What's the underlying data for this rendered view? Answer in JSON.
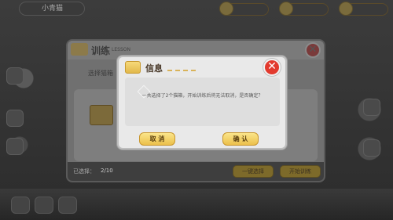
{
  "top_bar": {
    "player_label": "小青猫"
  },
  "training_panel": {
    "title": "训练",
    "subtitle": "LESSON",
    "select_prompt": "选择猫箱",
    "selected_label": "已选择：",
    "selected_count": "2/10",
    "select_all_button": "一键选择",
    "start_button": "开始训练"
  },
  "dialog": {
    "title": "信息",
    "message": "一共选择了2个猫箱，开始训练后将无法取消，是否确定？",
    "cancel_button": "取 消",
    "confirm_button": "确 认"
  },
  "icons": {
    "dialog_close": "close-icon",
    "panel_close": "close-icon",
    "title_box": "box-icon"
  },
  "colors": {
    "dialog_close_bg": "#e23a2e",
    "button_gold": "#ecc04c"
  }
}
